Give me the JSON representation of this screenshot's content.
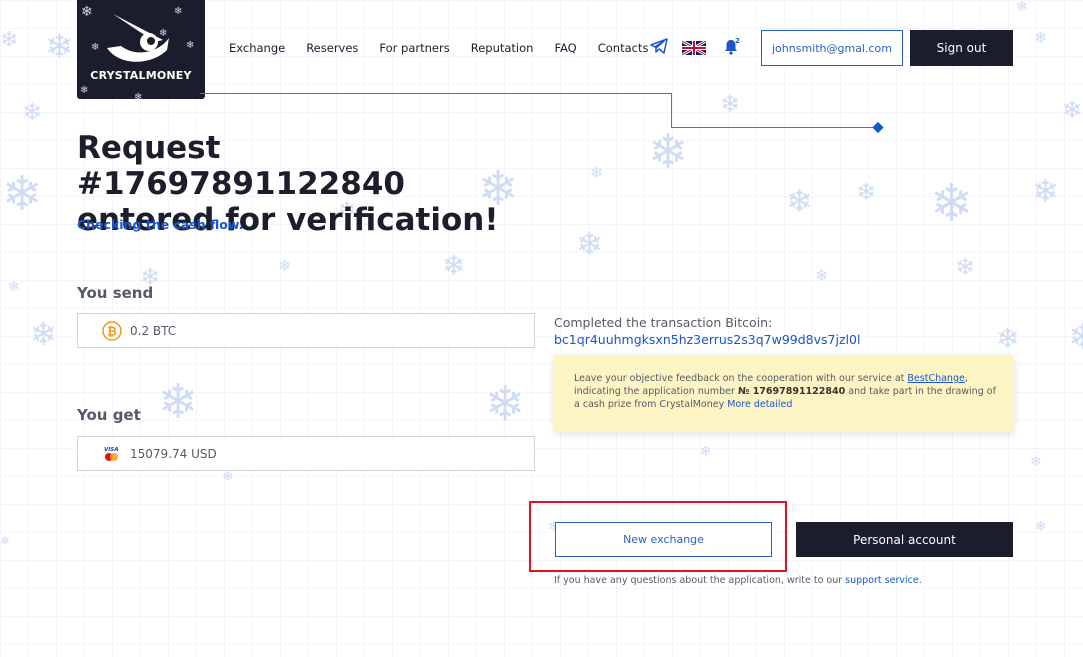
{
  "brand": {
    "name": "CRYSTALMONEY"
  },
  "nav": {
    "items": [
      "Exchange",
      "Reserves",
      "For partners",
      "Reputation",
      "FAQ",
      "Contacts"
    ]
  },
  "header": {
    "notification_count": "2",
    "email": "johnsmith@gmal.com",
    "signout_label": "Sign out",
    "icons": [
      "telegram-icon",
      "uk-flag-icon",
      "bell-icon"
    ]
  },
  "title": {
    "line1": "Request #17697891122840",
    "line2": "entered for verification!",
    "status": "Checking the cash flow."
  },
  "send": {
    "label": "You send",
    "value": "0.2 BTC",
    "icon": "bitcoin-icon"
  },
  "get": {
    "label": "You get",
    "value": "15079.74 USD",
    "icon": "visa-mastercard-icon"
  },
  "transaction": {
    "label": "Completed the transaction Bitcoin:",
    "hash": "bc1qr4uuhmgksxn5hz3errus2s3q7w99d8vs7jzl0l"
  },
  "notice": {
    "text1": "Leave your objective feedback on the cooperation with our service at ",
    "link1": "BestChange",
    "text2": ", indicating the application number ",
    "number": "№ 17697891122840",
    "text3": " and take part in the drawing of a cash prize from CrystalMoney ",
    "link2": "More detailed"
  },
  "actions": {
    "new_exchange": "New exchange",
    "personal_account": "Personal account"
  },
  "footer": {
    "text": "If you have any questions about the application, write to our ",
    "link": "support service",
    "end": "."
  },
  "colors": {
    "dark": "#1a1e2c",
    "accent": "#2a5fc7",
    "notice_bg": "#fdf4c4",
    "highlight": "#e2131a",
    "bitcoin": "#f7931a"
  }
}
